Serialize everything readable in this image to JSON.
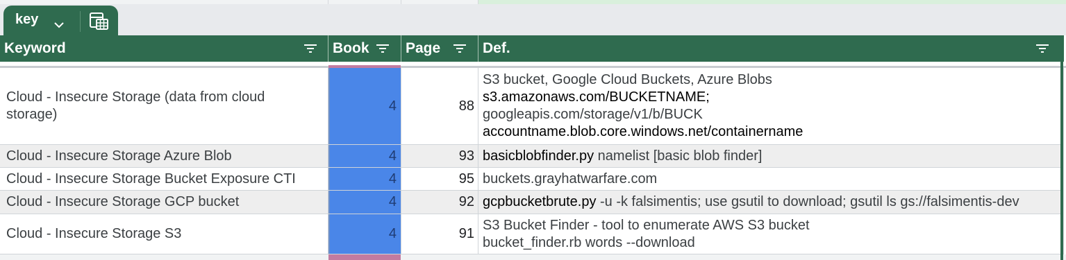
{
  "tab": {
    "name": "key",
    "chevron_icon": "chevron-down-icon",
    "view_icon": "calculator-table-icon"
  },
  "colors": {
    "header_bg": "#2f6b4f",
    "book_fill": "#4a86e8",
    "row_alt": "#eeeeee"
  },
  "columns": [
    {
      "label": "Keyword"
    },
    {
      "label": "Book"
    },
    {
      "label": "Page"
    },
    {
      "label": "Def."
    }
  ],
  "rows": [
    {
      "keyword": "Cloud - Insecure Storage (data from cloud storage)",
      "book": "4",
      "page": "88",
      "def_lines": [
        {
          "text": "S3 bucket, Google Cloud Buckets, Azure Blobs",
          "dark": false
        },
        {
          "text": "s3.amazonaws.com/BUCKETNAME;",
          "dark": true
        },
        {
          "text": "googleapis.com/storage/v1/b/BUCK",
          "dark": false
        },
        {
          "text": "accountname.blob.core.windows.net/containername",
          "dark": true
        }
      ]
    },
    {
      "keyword": "Cloud - Insecure Storage Azure Blob",
      "book": "4",
      "page": "93",
      "def_parts": [
        {
          "text": "basicblobfinder.py",
          "dark": true
        },
        {
          "text": " namelist [basic blob finder]",
          "dark": false
        }
      ]
    },
    {
      "keyword": "Cloud - Insecure Storage Bucket Exposure CTI",
      "book": "4",
      "page": "95",
      "def_parts": [
        {
          "text": "buckets.grayhatwarfare.com",
          "dark": false
        }
      ]
    },
    {
      "keyword": "Cloud - Insecure Storage GCP bucket",
      "book": "4",
      "page": "92",
      "def_parts": [
        {
          "text": "gcpbucketbrute.py",
          "dark": true
        },
        {
          "text": " -u -k falsimentis; use gsutil to download; gsutil ls gs://falsimentis-dev",
          "dark": false
        }
      ]
    },
    {
      "keyword": "Cloud - Insecure Storage S3",
      "book": "4",
      "page": "91",
      "def_lines": [
        {
          "text": "S3 Bucket Finder - tool to enumerate AWS S3 bucket",
          "dark": false
        },
        {
          "text": "bucket_finder.rb words --download",
          "dark": false
        }
      ]
    }
  ]
}
